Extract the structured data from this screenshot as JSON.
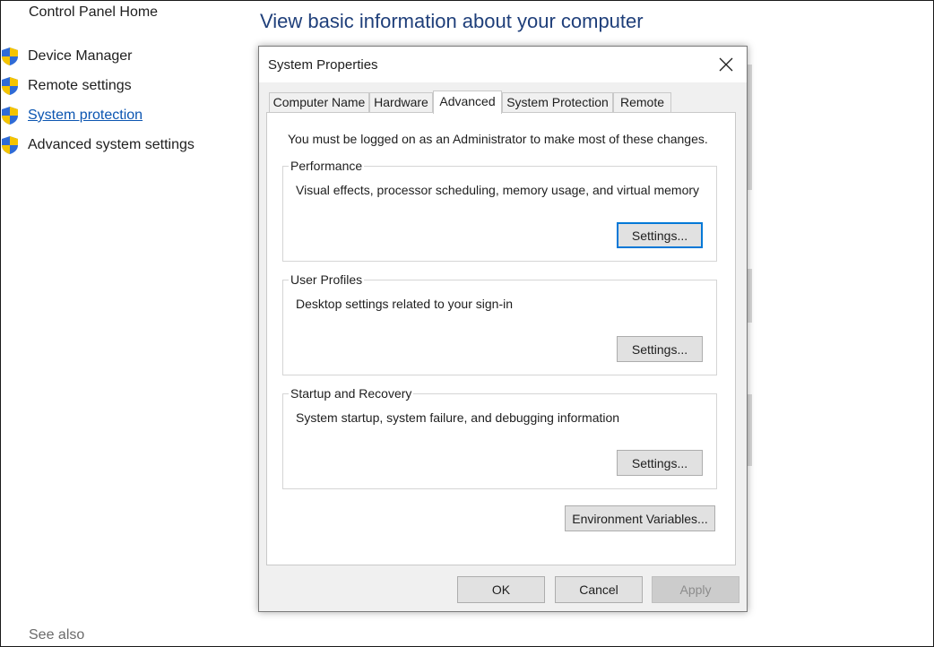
{
  "left_nav": {
    "home": "Control Panel Home",
    "items": [
      {
        "label": "Device Manager",
        "icon": "uac-shield-icon"
      },
      {
        "label": "Remote settings",
        "icon": "uac-shield-icon"
      },
      {
        "label": "System protection",
        "icon": "uac-shield-icon"
      },
      {
        "label": "Advanced system settings",
        "icon": "uac-shield-icon"
      }
    ],
    "see_also": "See also"
  },
  "main": {
    "title": "View basic information about your computer"
  },
  "dialog": {
    "title": "System Properties",
    "tabs": [
      "Computer Name",
      "Hardware",
      "Advanced",
      "System Protection",
      "Remote"
    ],
    "active_tab": "Advanced",
    "admin_note": "You must be logged on as an Administrator to make most of these changes.",
    "groups": [
      {
        "legend": "Performance",
        "description": "Visual effects, processor scheduling, memory usage, and virtual memory",
        "button": "Settings..."
      },
      {
        "legend": "User Profiles",
        "description": "Desktop settings related to your sign-in",
        "button": "Settings..."
      },
      {
        "legend": "Startup and Recovery",
        "description": "System startup, system failure, and debugging information",
        "button": "Settings..."
      }
    ],
    "env_button": "Environment Variables...",
    "ok": "OK",
    "cancel": "Cancel",
    "apply": "Apply"
  },
  "colors": {
    "link": "#0b55b1",
    "title_blue": "#1f3f7a",
    "focus_border": "#0078d7",
    "dialog_bg": "#f0f0f0"
  }
}
